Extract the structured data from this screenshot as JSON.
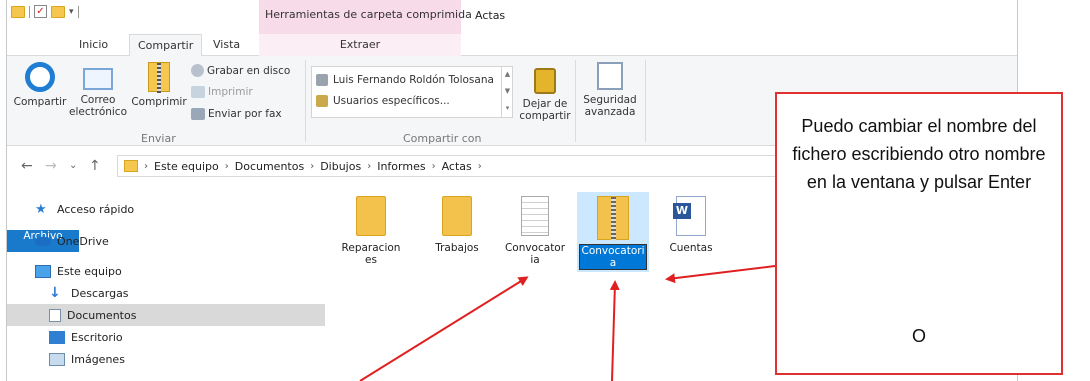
{
  "titlebar": {
    "contextual_title": "Herramientas de carpeta comprimida",
    "window_title": "Actas"
  },
  "tabs": {
    "file": "Archivo",
    "home": "Inicio",
    "share": "Compartir",
    "view": "Vista",
    "extract": "Extraer"
  },
  "ribbon": {
    "share_btn": "Compartir",
    "mail_btn_line1": "Correo",
    "mail_btn_line2": "electrónico",
    "zip_btn": "Comprimir",
    "burn_btn": "Grabar en disco",
    "print_btn": "Imprimir",
    "fax_btn": "Enviar por fax",
    "group_send": "Enviar",
    "person": "Luis Fernando Roldón Tolosana",
    "specific_users": "Usuarios específicos...",
    "stop_share_line1": "Dejar de",
    "stop_share_line2": "compartir",
    "security_line1": "Seguridad",
    "security_line2": "avanzada",
    "group_share_with": "Compartir con"
  },
  "address": {
    "crumbs": [
      "Este equipo",
      "Documentos",
      "Dibujos",
      "Informes",
      "Actas"
    ]
  },
  "nav": {
    "items": [
      "Acceso rápido",
      "OneDrive",
      "Este equipo",
      "Descargas",
      "Documentos",
      "Escritorio",
      "Imágenes"
    ]
  },
  "files": {
    "items": [
      "Reparaciones",
      "Trabajos",
      "Convocatoria",
      "Cuentas"
    ],
    "item0_line1": "Reparacion",
    "item0_line2": "es",
    "item1": "Trabajos",
    "item2_line1": "Convocator",
    "item2_line2": "ia",
    "item3_line1": "Convocatori",
    "item3_line2": "a",
    "item4": "Cuentas"
  },
  "callout": {
    "text": "Puedo cambiar el nombre del fichero escribiendo otro nombre en la ventana y pulsar Enter",
    "or": "O"
  },
  "colors": {
    "accent": "#1979ca",
    "callout_border": "#e03030",
    "arrow": "#e02020",
    "selection": "#0078d7"
  }
}
